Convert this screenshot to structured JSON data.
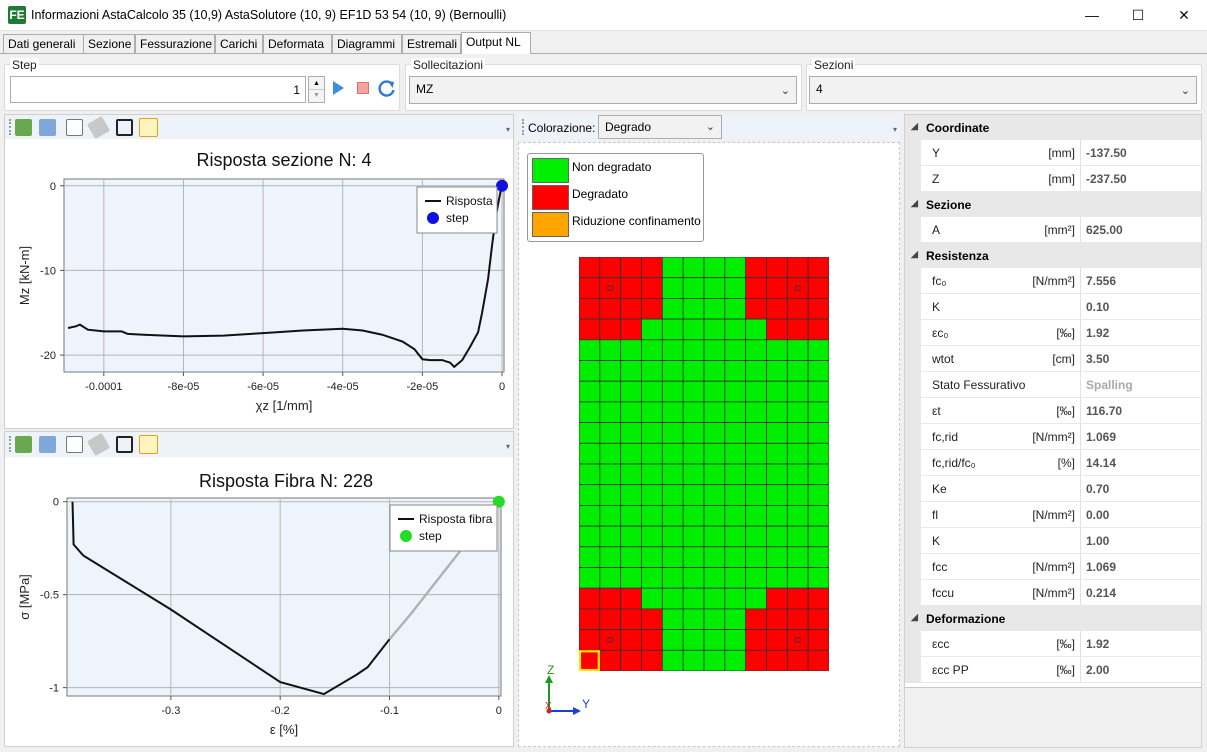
{
  "window": {
    "title": "Informazioni AstaCalcolo 35 (10,9) AstaSolutore (10, 9) EF1D 53 54  (10, 9) (Bernoulli)",
    "app_icon": "FE",
    "minimize": "—",
    "maximize": "☐",
    "close": "✕"
  },
  "tabs": [
    "Dati generali",
    "Sezione",
    "Fessurazione",
    "Carichi",
    "Deformata",
    "Diagrammi",
    "Estremali",
    "Output NL"
  ],
  "active_tab": "Output NL",
  "step": {
    "label": "Step",
    "value": "1"
  },
  "sollecitazioni": {
    "label": "Sollecitazioni",
    "value": "MZ"
  },
  "sezioni": {
    "label": "Sezioni",
    "value": "4"
  },
  "coloring": {
    "label": "Colorazione:",
    "value": "Degrado"
  },
  "colors": {
    "green": "#00ee00",
    "red": "#ff0000",
    "orange": "#ffa500"
  },
  "chart1": {
    "title": "Risposta sezione N: 4",
    "xlabel": "χz [1/mm]",
    "ylabel": "Mz [kN-m]",
    "yticks": [
      "0",
      "-10",
      "-20"
    ],
    "xticks": [
      "-0.0001",
      "-8e-05",
      "-6e-05",
      "-4e-05",
      "-2e-05",
      "0"
    ],
    "legend": [
      "Risposta",
      "step"
    ],
    "chart_data": {
      "type": "line",
      "xlim": [
        -0.00011,
        5e-07
      ],
      "ylim": [
        -22,
        0.8
      ],
      "series": [
        {
          "name": "Risposta",
          "x": [
            -0.000109,
            -0.000107,
            -0.000106,
            -0.000104,
            -0.0001,
            -9.55e-05,
            -9.4e-05,
            -9e-05,
            -8e-05,
            -7e-05,
            -6e-05,
            -5e-05,
            -4e-05,
            -3.5e-05,
            -3e-05,
            -2.5e-05,
            -2.2e-05,
            -2e-05,
            -1.8e-05,
            -1.5e-05,
            -1.3e-05,
            -1.2e-05,
            -1e-05,
            -8e-06,
            -6e-06,
            -5e-06,
            -3.5e-06,
            -2.5e-06,
            -1.5e-06,
            -5e-07,
            0
          ],
          "y": [
            -16.8,
            -16.6,
            -16.4,
            -17,
            -17.2,
            -17.2,
            -17.5,
            -17.6,
            -17.8,
            -17.7,
            -17.4,
            -17.1,
            -16.9,
            -17.1,
            -17.6,
            -18.4,
            -19.3,
            -20.5,
            -20.6,
            -20.6,
            -20.9,
            -21.4,
            -20.6,
            -19,
            -17.3,
            -15,
            -11,
            -7,
            -3.5,
            -1,
            0
          ]
        },
        {
          "name": "step",
          "x": [
            0
          ],
          "y": [
            0
          ]
        }
      ]
    }
  },
  "chart2": {
    "title": "Risposta Fibra N: 228",
    "xlabel": "ε [%]",
    "ylabel": "σ [MPa]",
    "yticks": [
      "0",
      "-0.5",
      "-1"
    ],
    "xticks": [
      "-0.3",
      "-0.2",
      "-0.1",
      "0"
    ],
    "legend": [
      "Risposta fibra",
      "step"
    ],
    "chart_data": {
      "type": "line",
      "xlim": [
        -0.395,
        0.002
      ],
      "ylim": [
        -1.045,
        0.02
      ],
      "series": [
        {
          "name": "Risposta fibra",
          "x": [
            -0.39,
            -0.3895,
            -0.389,
            -0.38,
            -0.3,
            -0.2,
            -0.16,
            -0.13,
            -0.12,
            -0.1,
            -0.08,
            -0.06,
            -0.04,
            -0.02,
            0
          ],
          "y": [
            0,
            -0.1,
            -0.23,
            -0.29,
            -0.58,
            -0.97,
            -1.035,
            -0.93,
            -0.89,
            -0.74,
            -0.6,
            -0.45,
            -0.3,
            -0.15,
            0
          ]
        },
        {
          "name": "step",
          "x": [
            0
          ],
          "y": [
            0
          ]
        }
      ]
    }
  },
  "section_legend": [
    "Non degradato",
    "Degradato",
    "Riduzione confinamento"
  ],
  "grid": {
    "rows": 20,
    "cols": 12,
    "cells": [
      "RRRRGGGGRRRR",
      "RRRRGGGGRRRR",
      "RRRRGGGGRRRR",
      "RRRGGGGGGRRR",
      "GGGGGGGGGGGG",
      "GGGGGGGGGGGG",
      "GGGGGGGGGGGG",
      "GGGGGGGGGGGG",
      "GGGGGGGGGGGG",
      "GGGGGGGGGGGG",
      "GGGGGGGGGGGG",
      "GGGGGGGGGGGG",
      "GGGGGGGGGGGG",
      "GGGGGGGGGGGG",
      "GGGGGGGGGGGG",
      "GGGGGGGGGGGG",
      "RRRGGGGGGRRR",
      "RRRRGGGGRRRR",
      "RRRRGGGGRRRR",
      "RRRRGGGGRRRR"
    ],
    "markers": [
      [
        1,
        1
      ],
      [
        1,
        10
      ],
      [
        18,
        1
      ],
      [
        18,
        10
      ]
    ],
    "selected": [
      19,
      0
    ]
  },
  "axes_labels": {
    "z": "Z",
    "y": "Y",
    "x": "X"
  },
  "properties": [
    {
      "cat": "Coordinate"
    },
    {
      "name": "Y",
      "unit": "[mm]",
      "value": "-137.50"
    },
    {
      "name": "Z",
      "unit": "[mm]",
      "value": "-237.50"
    },
    {
      "cat": "Sezione"
    },
    {
      "name": "A",
      "unit": "[mm²]",
      "value": "625.00"
    },
    {
      "cat": "Resistenza"
    },
    {
      "name": "fc₀",
      "unit": "[N/mm²]",
      "value": "7.556"
    },
    {
      "name": "K",
      "unit": "",
      "value": "0.10"
    },
    {
      "name": "εc₀",
      "unit": "[‰]",
      "value": "1.92"
    },
    {
      "name": "wtot",
      "unit": "[cm]",
      "value": "3.50"
    },
    {
      "name": "Stato Fessurativo",
      "unit": "",
      "value": "Spalling",
      "light": true
    },
    {
      "name": "εt",
      "unit": "[‰]",
      "value": "116.70"
    },
    {
      "name": "fc,rid",
      "unit": "[N/mm²]",
      "value": "1.069"
    },
    {
      "name": "fc,rid/fc₀",
      "unit": "[%]",
      "value": "14.14"
    },
    {
      "name": "Ke",
      "unit": "",
      "value": "0.70"
    },
    {
      "name": "fl",
      "unit": "[N/mm²]",
      "value": "0.00"
    },
    {
      "name": "K",
      "unit": "",
      "value": "1.00"
    },
    {
      "name": "fcc",
      "unit": "[N/mm²]",
      "value": "1.069"
    },
    {
      "name": "fccu",
      "unit": "[N/mm²]",
      "value": "0.214"
    },
    {
      "cat": "Deformazione"
    },
    {
      "name": "εcc",
      "unit": "[‰]",
      "value": "1.92"
    },
    {
      "name": "εcc PP",
      "unit": "[‰]",
      "value": "2.00"
    }
  ]
}
